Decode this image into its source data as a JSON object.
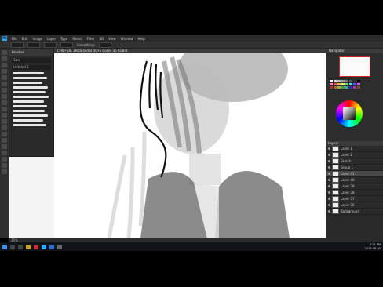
{
  "app": {
    "menu": [
      "File",
      "Edit",
      "Image",
      "Layer",
      "Type",
      "Select",
      "Filter",
      "3D",
      "View",
      "Window",
      "Help"
    ],
    "options_label": "Smoothing:",
    "doc_title": "CHIEF DE 1HDS and B DOFE Cover 35 RGB/8",
    "status_text": "35%"
  },
  "brushes": {
    "title": "Brushes",
    "size_label": "Size",
    "group_label": "Untitled 1"
  },
  "navigator": {
    "title": "Navigator"
  },
  "layers": {
    "title": "Layers",
    "items": [
      "Layer 1",
      "Layer 2",
      "Sketch",
      "Group 1",
      "Layer 41",
      "Layer 40",
      "Layer 39",
      "Layer 38",
      "Layer 37",
      "Layer 36",
      "Background"
    ]
  },
  "taskbar": {
    "time": "2:21 PM",
    "date": "2019-08-02"
  },
  "colors": {
    "ps_blue": "#31a8ff",
    "panel_dark": "#2d2d2d",
    "canvas_bg": "#ffffff"
  },
  "taskbar_icons": [
    "windows-icon",
    "search-icon",
    "taskview-icon",
    "explorer-icon",
    "chrome-icon",
    "photoshop-icon",
    "mail-icon",
    "store-icon"
  ]
}
